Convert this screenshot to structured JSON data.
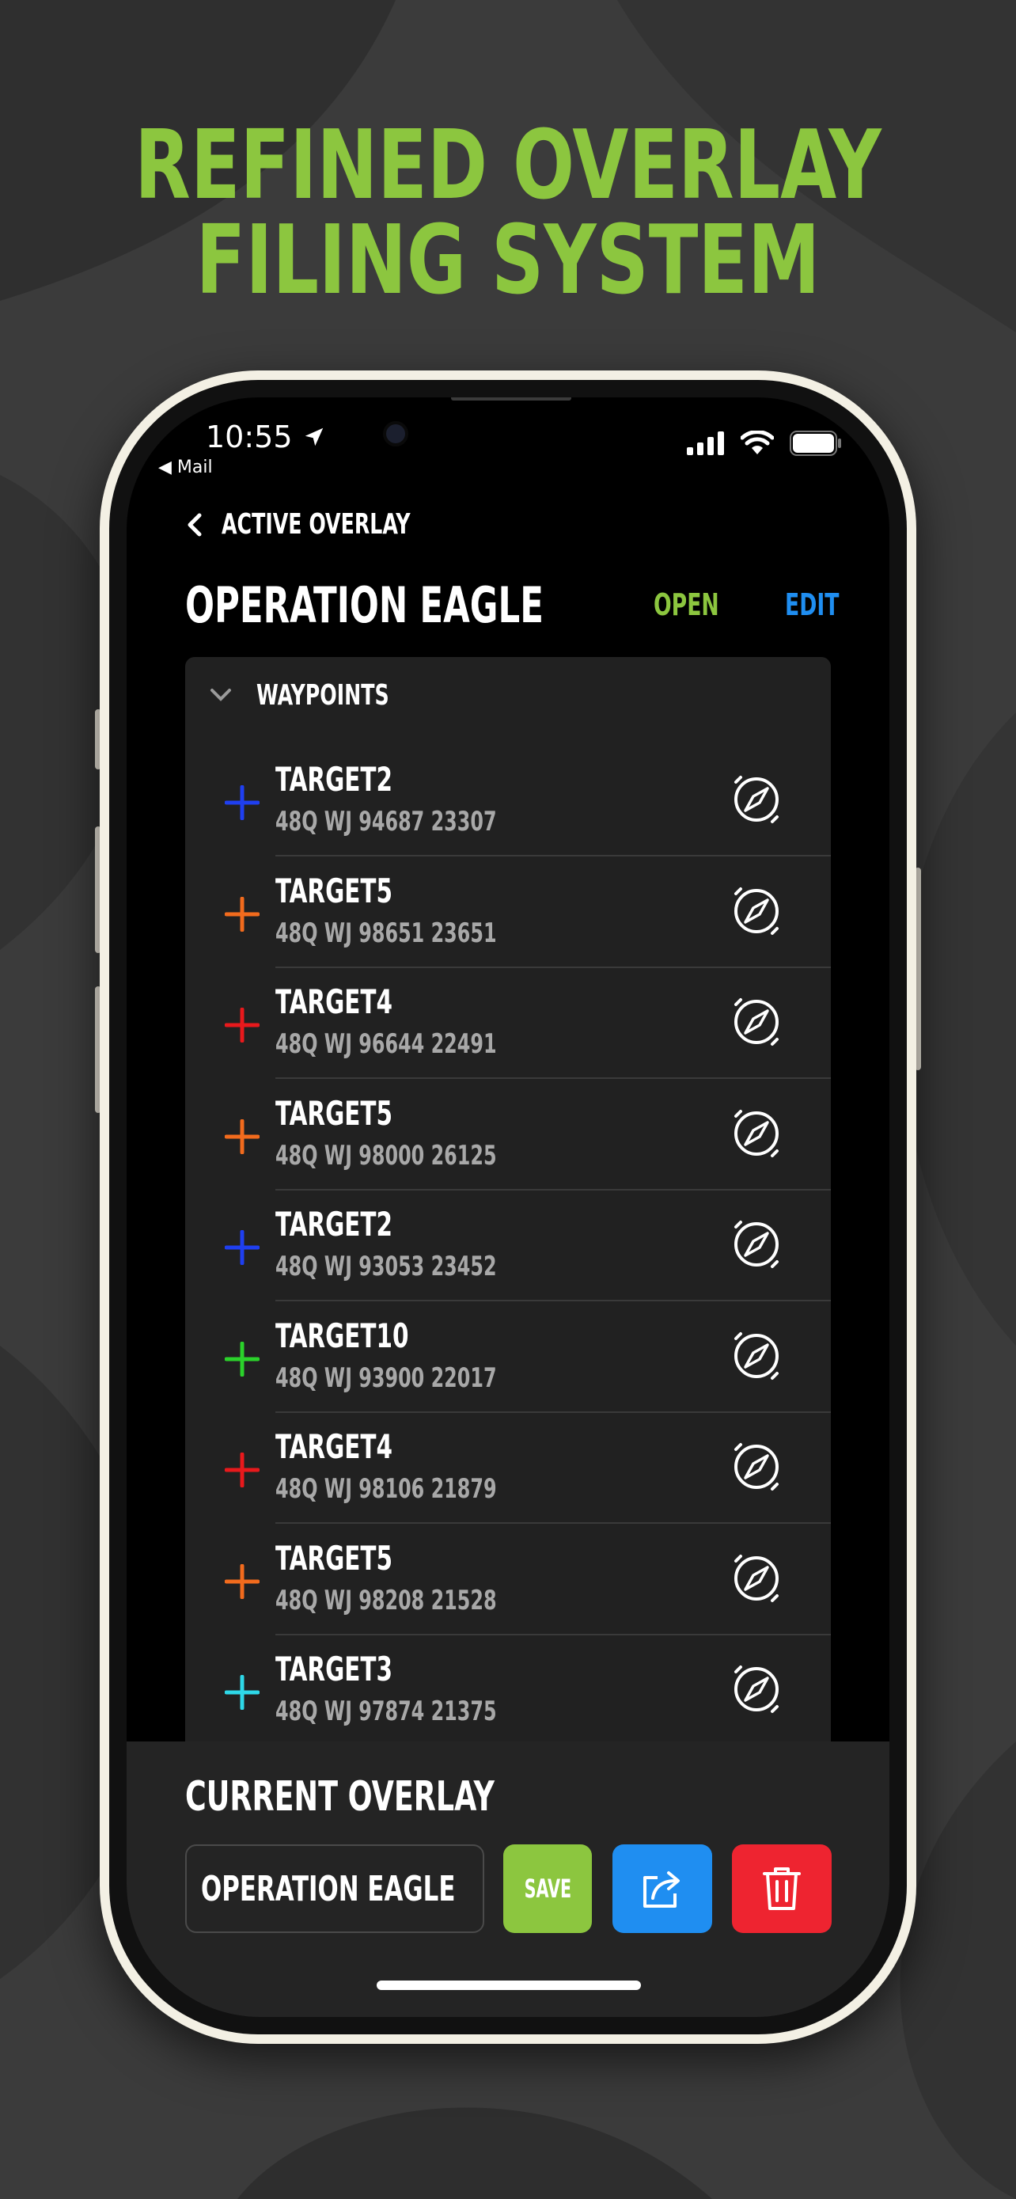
{
  "headline": {
    "line1": "REFINED OVERLAY",
    "line2": "FILING SYSTEM"
  },
  "colors": {
    "accent_green": "#8cc63f",
    "accent_blue": "#1f8ef1",
    "danger_red": "#ee2430"
  },
  "status_bar": {
    "time": "10:55",
    "back_app": "◀ Mail"
  },
  "nav": {
    "back_label": "ACTIVE OVERLAY"
  },
  "overlay": {
    "title": "OPERATION EAGLE",
    "open_label": "OPEN",
    "edit_label": "EDIT"
  },
  "waypoints": {
    "section_label": "WAYPOINTS",
    "items": [
      {
        "name": "TARGET2",
        "coord": "48Q WJ 94687 23307",
        "color": "#1f3ff0"
      },
      {
        "name": "TARGET5",
        "coord": "48Q WJ 98651 23651",
        "color": "#f26b1d"
      },
      {
        "name": "TARGET4",
        "coord": "48Q WJ 96644 22491",
        "color": "#e8191c"
      },
      {
        "name": "TARGET5",
        "coord": "48Q WJ 98000 26125",
        "color": "#f26b1d"
      },
      {
        "name": "TARGET2",
        "coord": "48Q WJ 93053 23452",
        "color": "#1f3ff0"
      },
      {
        "name": "TARGET10",
        "coord": "48Q WJ 93900 22017",
        "color": "#2bd22b"
      },
      {
        "name": "TARGET4",
        "coord": "48Q WJ 98106 21879",
        "color": "#e8191c"
      },
      {
        "name": "TARGET5",
        "coord": "48Q WJ 98208 21528",
        "color": "#f26b1d"
      },
      {
        "name": "TARGET3",
        "coord": "48Q WJ 97874 21375",
        "color": "#2ed8e8"
      }
    ]
  },
  "current_overlay": {
    "label": "CURRENT OVERLAY",
    "name_value": "OPERATION EAGLE",
    "save_label": "SAVE",
    "share_icon": "share-icon",
    "delete_icon": "trash-icon"
  }
}
